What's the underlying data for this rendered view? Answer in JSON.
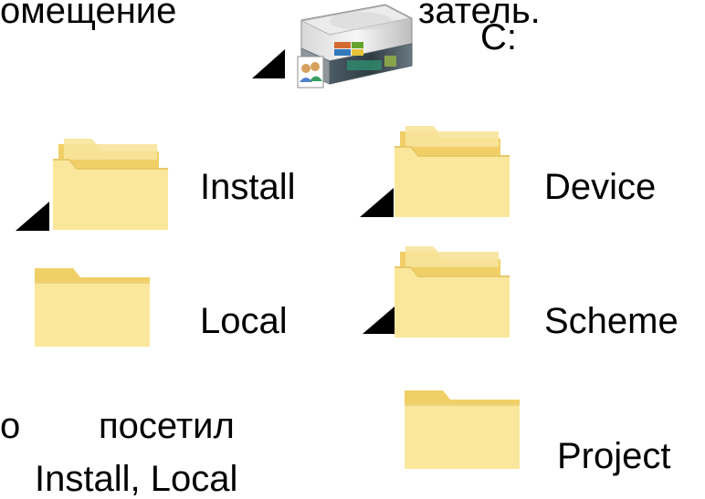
{
  "top_text": {
    "left_fragment": "омещение",
    "right_fragment": "затель."
  },
  "drive": {
    "label": "C:",
    "icon": "hard-drive-icon"
  },
  "folders": [
    {
      "label": "Install",
      "icon": "folder-icon",
      "has_expander": true
    },
    {
      "label": "Device",
      "icon": "folder-icon",
      "has_expander": true
    },
    {
      "label": "Local",
      "icon": "folder-icon",
      "has_expander": false
    },
    {
      "label": "Scheme",
      "icon": "folder-icon",
      "has_expander": true
    },
    {
      "label": "Project",
      "icon": "folder-icon",
      "has_expander": false
    }
  ],
  "bottom_text": {
    "line1_left": "о",
    "line1_right": "посетил",
    "line2": "Install, Local"
  },
  "colors": {
    "folder_back": "#f1cf67",
    "folder_front": "#fbe79c",
    "expander": "#000000"
  }
}
